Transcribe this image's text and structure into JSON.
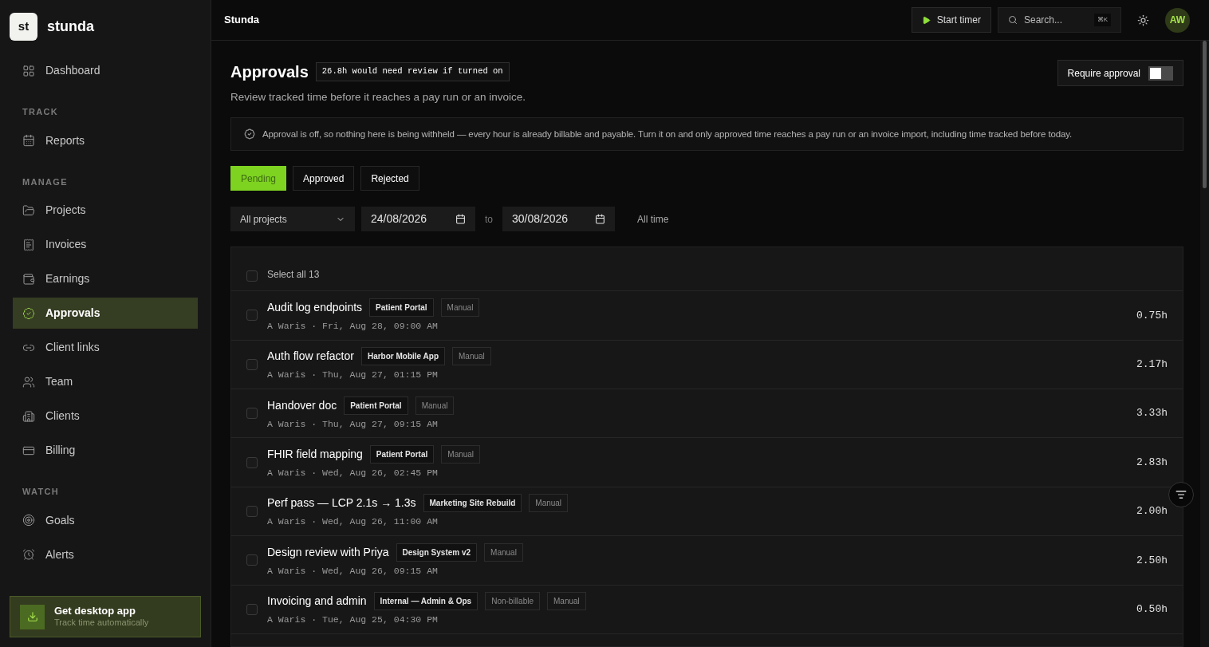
{
  "brand": {
    "mark": "st",
    "name": "stunda"
  },
  "sidebar": {
    "sections": [
      {
        "items": [
          {
            "label": "Dashboard",
            "selected": false
          }
        ]
      },
      {
        "heading": "TRACK",
        "items": [
          {
            "label": "Reports",
            "selected": false
          }
        ]
      },
      {
        "heading": "MANAGE",
        "items": [
          {
            "label": "Projects",
            "selected": false
          },
          {
            "label": "Invoices",
            "selected": false
          },
          {
            "label": "Earnings",
            "selected": false
          },
          {
            "label": "Approvals",
            "selected": true
          },
          {
            "label": "Client links",
            "selected": false
          },
          {
            "label": "Team",
            "selected": false
          },
          {
            "label": "Clients",
            "selected": false
          },
          {
            "label": "Billing",
            "selected": false
          }
        ]
      },
      {
        "heading": "WATCH",
        "items": [
          {
            "label": "Goals",
            "selected": false
          },
          {
            "label": "Alerts",
            "selected": false
          }
        ]
      }
    ],
    "promo": {
      "title": "Get desktop app",
      "subtitle": "Track time automatically"
    }
  },
  "topbar": {
    "title": "Stunda",
    "start_timer": "Start timer",
    "search": {
      "placeholder": "Search...",
      "shortcut": "⌘K"
    },
    "avatar": "AW"
  },
  "page": {
    "title": "Approvals",
    "badge": "26.8h would need review if turned on",
    "subtitle": "Review tracked time before it reaches a pay run or an invoice.",
    "require_approval": {
      "label": "Require approval",
      "on": false
    },
    "notice": "Approval is off, so nothing here is being withheld — every hour is already billable and payable. Turn it on and only approved time reaches a pay run or an invoice import, including time tracked before today.",
    "tabs": [
      {
        "label": "Pending",
        "selected": true
      },
      {
        "label": "Approved",
        "selected": false
      },
      {
        "label": "Rejected",
        "selected": false
      }
    ],
    "filters": {
      "project": "All projects",
      "from": "24/08/2026",
      "to_label": "to",
      "to": "30/08/2026",
      "all_time": "All time"
    },
    "select_all": {
      "label": "Select all 13",
      "checked": false
    },
    "entries": [
      {
        "title": "Audit log endpoints",
        "tags": [
          {
            "label": "Patient Portal",
            "kind": "project"
          },
          {
            "label": "Manual",
            "kind": "flag"
          }
        ],
        "meta": "A Waris · Fri, Aug 28, 09:00 AM",
        "hours": "0.75h",
        "checked": false
      },
      {
        "title": "Auth flow refactor",
        "tags": [
          {
            "label": "Harbor Mobile App",
            "kind": "project"
          },
          {
            "label": "Manual",
            "kind": "flag"
          }
        ],
        "meta": "A Waris · Thu, Aug 27, 01:15 PM",
        "hours": "2.17h",
        "checked": false
      },
      {
        "title": "Handover doc",
        "tags": [
          {
            "label": "Patient Portal",
            "kind": "project"
          },
          {
            "label": "Manual",
            "kind": "flag"
          }
        ],
        "meta": "A Waris · Thu, Aug 27, 09:15 AM",
        "hours": "3.33h",
        "checked": false
      },
      {
        "title": "FHIR field mapping",
        "tags": [
          {
            "label": "Patient Portal",
            "kind": "project"
          },
          {
            "label": "Manual",
            "kind": "flag"
          }
        ],
        "meta": "A Waris · Wed, Aug 26, 02:45 PM",
        "hours": "2.83h",
        "checked": false
      },
      {
        "title": "Perf pass — LCP 2.1s → 1.3s",
        "tags": [
          {
            "label": "Marketing Site Rebuild",
            "kind": "project"
          },
          {
            "label": "Manual",
            "kind": "flag"
          }
        ],
        "meta": "A Waris · Wed, Aug 26, 11:00 AM",
        "hours": "2.00h",
        "checked": false
      },
      {
        "title": "Design review with Priya",
        "tags": [
          {
            "label": "Design System v2",
            "kind": "project"
          },
          {
            "label": "Manual",
            "kind": "flag"
          }
        ],
        "meta": "A Waris · Wed, Aug 26, 09:15 AM",
        "hours": "2.50h",
        "checked": false
      },
      {
        "title": "Invoicing and admin",
        "tags": [
          {
            "label": "Internal — Admin & Ops",
            "kind": "project"
          },
          {
            "label": "Non-billable",
            "kind": "flag"
          },
          {
            "label": "Manual",
            "kind": "flag"
          }
        ],
        "meta": "A Waris · Tue, Aug 25, 04:30 PM",
        "hours": "0.50h",
        "checked": false
      }
    ]
  }
}
